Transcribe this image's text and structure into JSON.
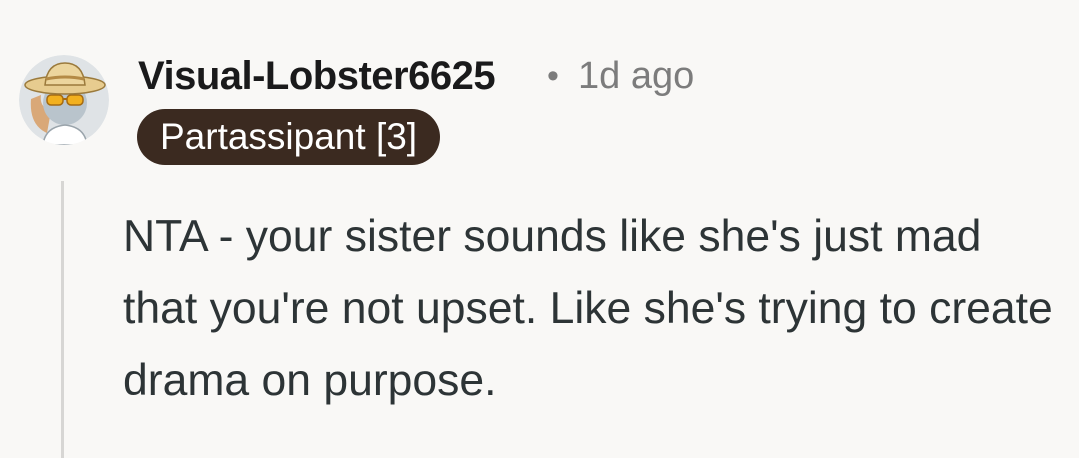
{
  "comment": {
    "author": "Visual-Lobster6625",
    "separator": "•",
    "timestamp": "1d ago",
    "flair": "Partassipant [3]",
    "body": "NTA - your sister sounds like she's just mad that you're not upset. Like she's trying to create drama on purpose."
  },
  "colors": {
    "background": "#f9f8f6",
    "flair_background": "#3b2a20",
    "flair_text": "#ffffff",
    "author_text": "#1a1a1b",
    "meta_text": "#7c7c7c",
    "body_text": "#2d3436",
    "thread_line": "#d7d6d4"
  },
  "icons": {
    "avatar": "snoo-avatar-with-hat-and-sunglasses"
  }
}
